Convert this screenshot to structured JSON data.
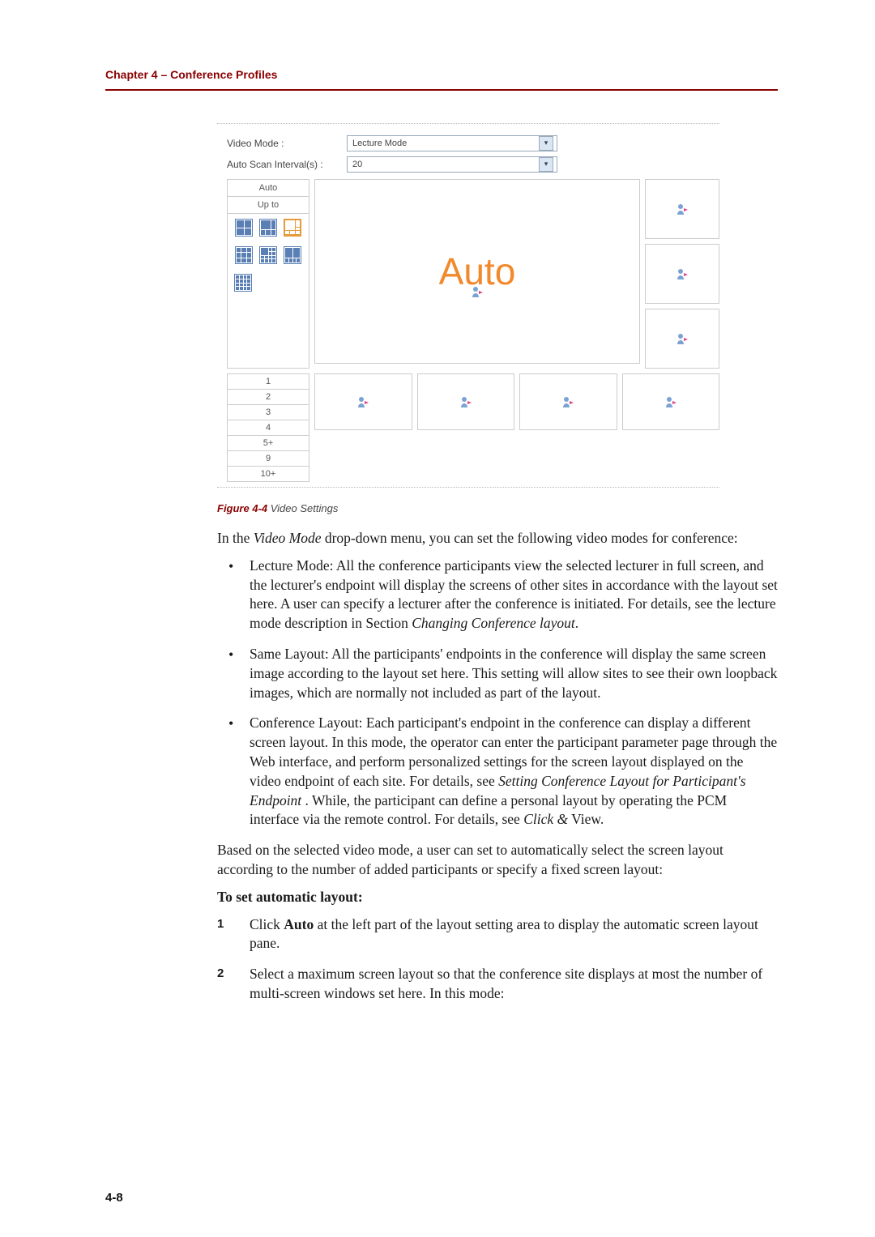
{
  "header": {
    "chapter": "Chapter 4 – Conference Profiles"
  },
  "figure": {
    "video_mode_label": "Video Mode :",
    "video_mode_value": "Lecture Mode",
    "auto_scan_label": "Auto Scan Interval(s) :",
    "auto_scan_value": "20",
    "side_auto": "Auto",
    "side_upto": "Up to",
    "auto_word": "Auto",
    "numlist": [
      "1",
      "2",
      "3",
      "4",
      "5+",
      "9",
      "10+"
    ]
  },
  "caption": {
    "num": "Figure 4-4",
    "title": " Video Settings"
  },
  "text": {
    "intro_a": "In the ",
    "intro_em": "Video Mode",
    "intro_b": " drop-down menu, you can set the following video modes for conference:",
    "b1": "Lecture Mode: All the conference participants view the selected lecturer in full screen, and the lecturer's endpoint will display the screens of other sites in accordance with the layout set here. A user can specify a lecturer after the conference is initiated. For details, see the lecture mode description in Section ",
    "b1_em": "Changing Conference layout",
    "b1_end": ".",
    "b2": "Same Layout: All the participants' endpoints in the conference will display the same screen image according to the layout set here. This setting will allow sites to see their own loopback images, which are normally not included as part of the layout.",
    "b3": "Conference Layout: Each participant's endpoint in the conference can display a different screen layout. In this mode, the operator can enter the participant parameter page through the Web interface, and perform personalized settings for the screen layout displayed on the video endpoint of each site. For details, see ",
    "b3_em1": "Setting Conference Layout for Participant's Endpoint",
    "b3_mid": " . While, the participant can define a personal layout by operating the PCM interface via the remote control. For details, see ",
    "b3_em2": "Click &",
    "b3_end": " View.",
    "based": "Based on the selected video mode, a user can set to automatically select the screen layout according to the number of added participants or specify a fixed screen layout:",
    "subhead": "To set automatic layout:",
    "n1_a": "Click ",
    "n1_bold": "Auto",
    "n1_b": " at the left part of the layout setting area to display the automatic screen layout pane.",
    "n2": "Select a maximum screen layout so that the conference site displays at most the number of multi-screen windows set here. In this mode:"
  },
  "pagenum": "4-8"
}
